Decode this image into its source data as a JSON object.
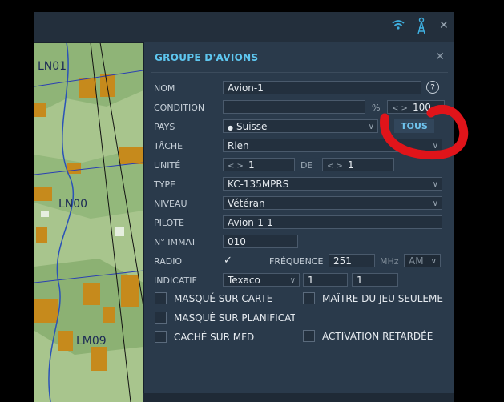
{
  "map": {
    "grid_labels": [
      "LN01",
      "LN00",
      "LM09"
    ]
  },
  "topbar": {
    "icons": [
      "wifi-icon",
      "antenna-icon",
      "close-icon"
    ]
  },
  "panel": {
    "title": "GROUPE D'AVIONS",
    "fields": {
      "nom_label": "NOM",
      "nom_value": "Avion-1",
      "condition_label": "CONDITION",
      "condition_value": "",
      "condition_percent": "%",
      "condition_stepper": "100",
      "pays_label": "PAYS",
      "pays_value": "Suisse",
      "tous_label": "TOUS",
      "tache_label": "TÂCHE",
      "tache_value": "Rien",
      "unite_label": "UNITÉ",
      "unite_value": "1",
      "de_label": "DE",
      "de_value": "1",
      "type_label": "TYPE",
      "type_value": "KC-135MPRS",
      "niveau_label": "NIVEAU",
      "niveau_value": "Vétéran",
      "pilote_label": "PILOTE",
      "pilote_value": "Avion-1-1",
      "immat_label": "N° IMMAT",
      "immat_value": "010",
      "radio_label": "RADIO",
      "frequence_label": "FRÉQUENCE",
      "frequence_value": "251",
      "mhz_label": "MHz",
      "mod_value": "AM",
      "indicatif_label": "INDICATIF",
      "indicatif_value": "Texaco",
      "indicatif_n1": "1",
      "indicatif_n2": "1"
    },
    "checkboxes": {
      "masque_carte": "MASQUÉ SUR CARTE",
      "maitre_jeu": "MAÎTRE DU JEU SEULEMENT",
      "masque_planif": "MASQUÉ SUR PLANIFICATION",
      "cache_mfd": "CACHÉ SUR MFD",
      "activation": "ACTIVATION RETARDÉE"
    },
    "radio_checked": true
  },
  "colors": {
    "accent": "#5ec6ef",
    "panel_bg": "#2a3a4b",
    "annotation_red": "#e0141a"
  }
}
